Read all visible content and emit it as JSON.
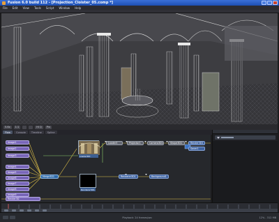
{
  "window": {
    "title": "Fusion 6.0 build 112 - [Projection_Cloister_05.comp *]"
  },
  "menu": [
    "File",
    "Edit",
    "View",
    "Tools",
    "Script",
    "Window",
    "Help"
  ],
  "viewer": {
    "buttons": [
      "5.6x",
      "1:1",
      "Hi Q",
      "Prx"
    ]
  },
  "tabs": [
    "Flow",
    "Console",
    "Timeline",
    "Spline"
  ],
  "properties": {
    "panel_tab": "Tools",
    "row_label": "Transform"
  },
  "flow": {
    "loaders": [
      "Image1",
      "Image2",
      "Image3",
      "Image4",
      "Image5",
      "Image6",
      "Image7",
      "Image8",
      "Image9"
    ],
    "hub": "Merge3D1",
    "upper_chain": [
      "Loader3",
      "Projector1",
      "Camera3D1",
      "Shape3D1",
      "Render3D1",
      "Saver1"
    ],
    "lower_chain": [
      "Renderer3D1",
      "Background1"
    ],
    "thumb_top": "Loader3DI",
    "thumb_bottom": "Renderer3D1",
    "bottom_node": "Render3D"
  },
  "status": {
    "center": "Playback: 24 frames/sec",
    "right": "12% - 312 MB"
  },
  "colors": {
    "titlebar": "#1d4fb4",
    "loader": "#7866b8",
    "node": "#3f63a0",
    "background": "#26282c"
  }
}
